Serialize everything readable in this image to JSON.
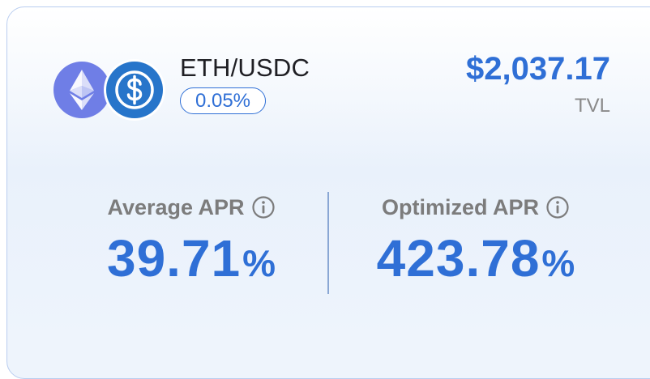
{
  "pool": {
    "pair": "ETH/USDC",
    "fee": "0.05%",
    "tokens": [
      {
        "symbol": "ETH",
        "icon": "ethereum-icon",
        "color": "#6f7ee6"
      },
      {
        "symbol": "USDC",
        "icon": "usdc-icon",
        "color": "#2775ca"
      }
    ]
  },
  "tvl": {
    "value": "$2,037.17",
    "label": "TVL"
  },
  "metrics": {
    "average": {
      "label": "Average APR",
      "value": "39.71",
      "unit": "%"
    },
    "optimized": {
      "label": "Optimized APR",
      "value": "423.78",
      "unit": "%"
    }
  },
  "colors": {
    "accent": "#2f6fd6",
    "muted": "#7c7c7c",
    "border": "#b9cdf0"
  }
}
